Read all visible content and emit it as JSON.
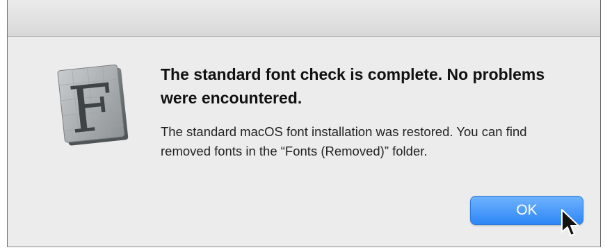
{
  "app_icon": {
    "name": "font-book-icon",
    "letter": "F"
  },
  "dialog": {
    "heading": "The standard font check is complete. No problems were encountered.",
    "message": "The standard macOS font installation was restored. You can find removed fonts in the “Fonts (Removed)” folder."
  },
  "buttons": {
    "ok_label": "OK"
  },
  "colors": {
    "dialog_background": "#ececec",
    "button_accent": "#2d86f5",
    "button_text": "#ffffff"
  }
}
